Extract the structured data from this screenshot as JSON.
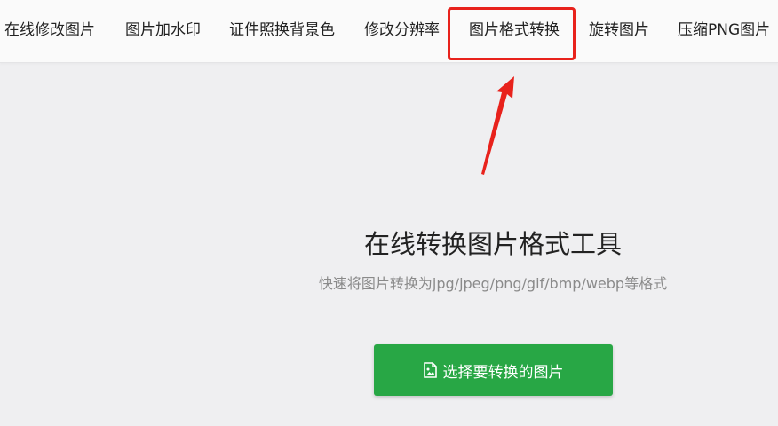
{
  "nav": {
    "items": [
      {
        "label": "在线修改图片"
      },
      {
        "label": "图片加水印"
      },
      {
        "label": "证件照换背景色"
      },
      {
        "label": "修改分辨率"
      },
      {
        "label": "图片格式转换",
        "highlighted": true
      },
      {
        "label": "旋转图片"
      },
      {
        "label": "压缩PNG图片"
      }
    ]
  },
  "hero": {
    "title": "在线转换图片格式工具",
    "subtitle": "快速将图片转换为jpg/jpeg/png/gif/bmp/webp等格式"
  },
  "upload_button": {
    "label": "选择要转换的图片",
    "icon": "image-file-icon"
  },
  "colors": {
    "accent_green": "#28a745",
    "highlight_red": "#e8221c",
    "background": "#efeff1"
  }
}
